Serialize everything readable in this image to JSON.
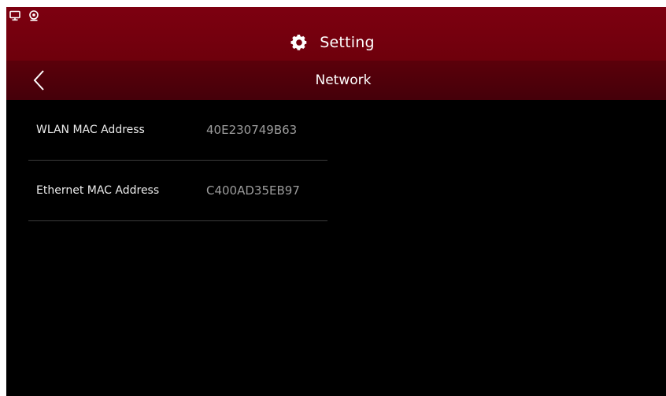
{
  "status_bar": {
    "icons": [
      "monitor-icon",
      "webcam-icon"
    ]
  },
  "header": {
    "title": "Setting",
    "icon": "gear-icon"
  },
  "subheader": {
    "back_icon": "chevron-left-icon",
    "title": "Network"
  },
  "network": {
    "rows": [
      {
        "label": "WLAN MAC Address",
        "value": "40E230749B63"
      },
      {
        "label": "Ethernet MAC Address",
        "value": "C400AD35EB97"
      }
    ]
  },
  "colors": {
    "header_bg": "#7d0010",
    "subheader_bg": "#52000a",
    "background": "#000000",
    "label_text": "#ececec",
    "value_text": "#9c9c9c",
    "divider": "#3a3a3a"
  }
}
